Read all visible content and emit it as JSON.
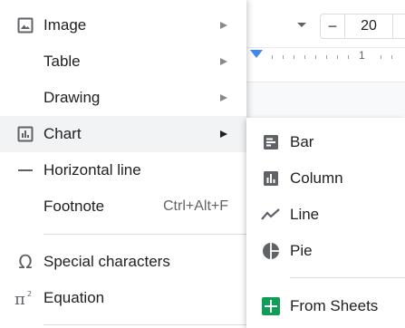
{
  "toolbar": {
    "font_size": "20",
    "minus_label": "−",
    "ruler_number": "1"
  },
  "insert_menu": {
    "items": [
      {
        "label": "Image",
        "icon": "image-icon",
        "has_submenu": true
      },
      {
        "label": "Table",
        "has_submenu": true
      },
      {
        "label": "Drawing",
        "has_submenu": true
      },
      {
        "label": "Chart",
        "icon": "chart-icon",
        "has_submenu": true,
        "highlighted": true
      },
      {
        "label": "Horizontal line",
        "icon": "horizontal-line-icon"
      },
      {
        "label": "Footnote",
        "shortcut": "Ctrl+Alt+F"
      },
      {
        "label": "Special characters",
        "icon": "omega-icon"
      },
      {
        "label": "Equation",
        "icon": "pi-squared-icon"
      }
    ]
  },
  "chart_submenu": {
    "items": [
      {
        "label": "Bar",
        "icon": "bar-chart-icon"
      },
      {
        "label": "Column",
        "icon": "column-chart-icon"
      },
      {
        "label": "Line",
        "icon": "line-chart-icon"
      },
      {
        "label": "Pie",
        "icon": "pie-chart-icon"
      },
      {
        "label": "From Sheets",
        "icon": "sheets-icon"
      }
    ]
  },
  "colors": {
    "highlight": "#f1f3f4",
    "icon": "#5f6368",
    "text": "#202124",
    "sheets_green": "#0f9d58",
    "ruler_marker": "#4285f4"
  }
}
